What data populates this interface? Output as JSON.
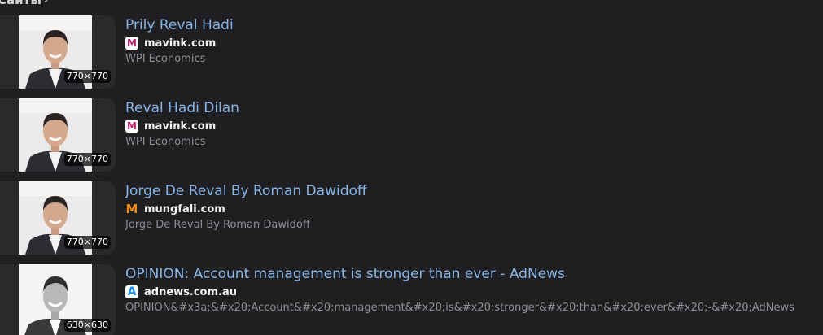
{
  "section": {
    "title": "Сайты",
    "chevron_icon": "chevron-right-icon"
  },
  "results": [
    {
      "title": "Prily Reval Hadi",
      "domain": "mavink.com",
      "favicon": "mavink-favicon-icon",
      "description": "WPI Economics",
      "image_size": "770×770"
    },
    {
      "title": "Reval Hadi Dilan",
      "domain": "mavink.com",
      "favicon": "mavink-favicon-icon",
      "description": "WPI Economics",
      "image_size": "770×770"
    },
    {
      "title": "Jorge De Reval By Roman Dawidoff",
      "domain": "mungfali.com",
      "favicon": "mungfali-favicon-icon",
      "description": "Jorge De Reval By Roman Dawidoff",
      "image_size": "770×770"
    },
    {
      "title": "OPINION: Account management is stronger than ever - AdNews",
      "domain": "adnews.com.au",
      "favicon": "adnews-favicon-icon",
      "description": "OPINION&#x3a;&#x20;Account&#x20;management&#x20;is&#x20;stronger&#x20;than&#x20;ever&#x20;-&#x20;AdNews",
      "image_size": "630×630"
    }
  ]
}
